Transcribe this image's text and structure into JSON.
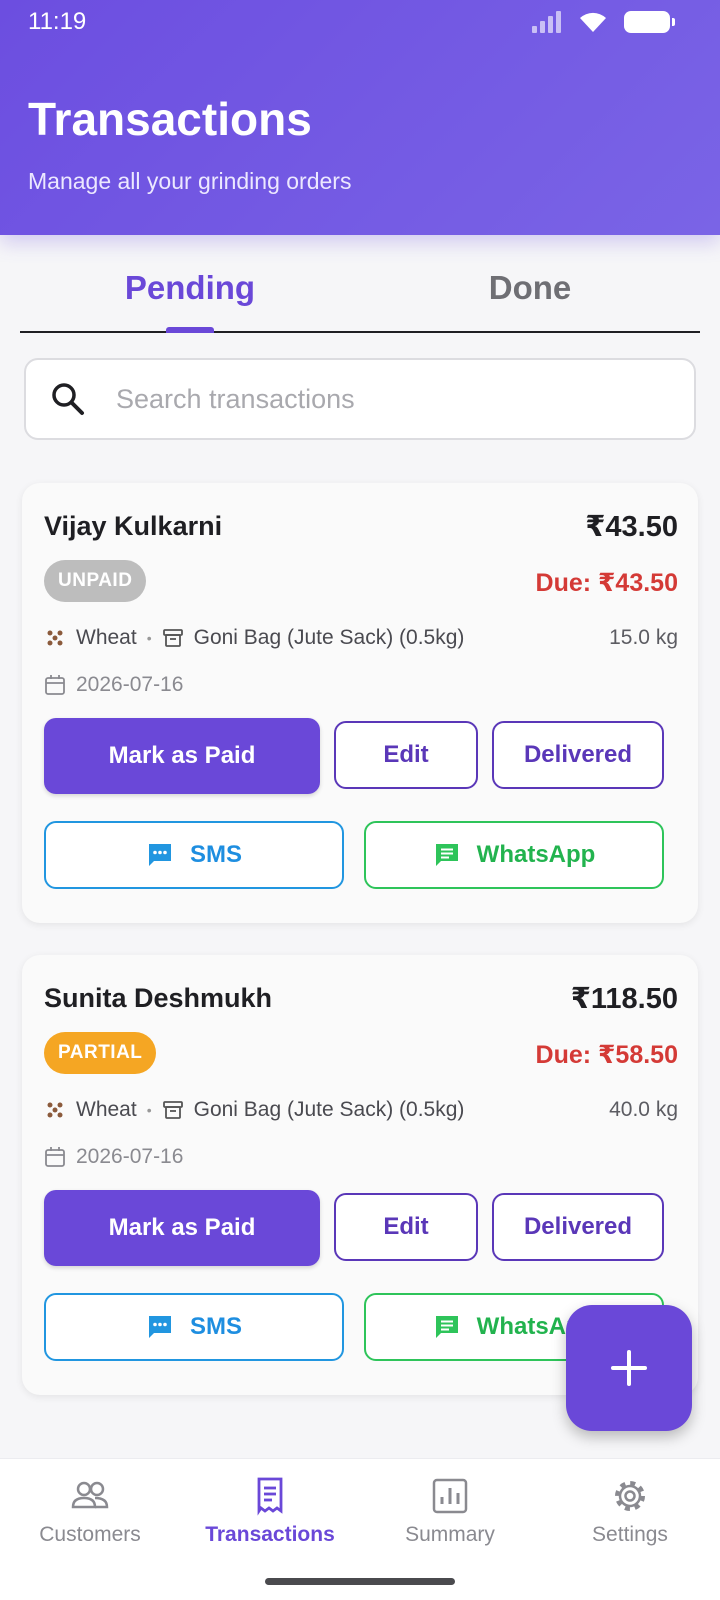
{
  "status_bar": {
    "time": "11:19"
  },
  "header": {
    "title": "Transactions",
    "subtitle": "Manage all your grinding orders"
  },
  "tabs": [
    {
      "label": "Pending",
      "active": true
    },
    {
      "label": "Done",
      "active": false
    }
  ],
  "search": {
    "placeholder": "Search transactions",
    "value": ""
  },
  "transactions": [
    {
      "name": "Vijay Kulkarni",
      "amount": "₹43.50",
      "status": "UNPAID",
      "status_color": "#bdbdbd",
      "due": "Due: ₹43.50",
      "grain": "Wheat",
      "bag": "Goni Bag (Jute Sack) (0.5kg)",
      "weight": "15.0 kg",
      "date": "2026-07-16"
    },
    {
      "name": "Sunita Deshmukh",
      "amount": "₹118.50",
      "status": "PARTIAL",
      "status_color": "#f5a623",
      "due": "Due: ₹58.50",
      "grain": "Wheat",
      "bag": "Goni Bag (Jute Sack) (0.5kg)",
      "weight": "40.0 kg",
      "date": "2026-07-16"
    }
  ],
  "actions": {
    "mark_paid": "Mark as Paid",
    "edit": "Edit",
    "delivered": "Delivered",
    "sms": "SMS",
    "whatsapp": "WhatsApp"
  },
  "bottom_nav": [
    {
      "label": "Customers",
      "icon": "people-icon",
      "active": false
    },
    {
      "label": "Transactions",
      "icon": "receipt-icon",
      "active": true
    },
    {
      "label": "Summary",
      "icon": "bar-chart-icon",
      "active": false
    },
    {
      "label": "Settings",
      "icon": "gear-icon",
      "active": false
    }
  ],
  "colors": {
    "primary": "#6a48d8",
    "due": "#d43a36",
    "sms": "#2196e0",
    "whatsapp": "#2ec45a"
  }
}
